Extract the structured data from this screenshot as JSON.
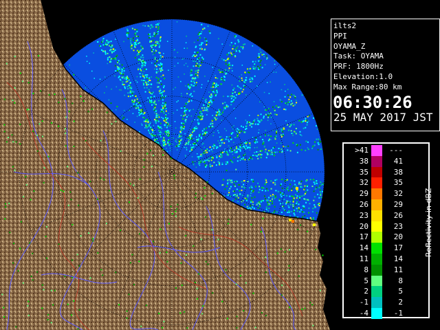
{
  "window": {
    "width": 640,
    "height": 480
  },
  "info": {
    "station": "ilts2",
    "mode": "PPI",
    "product": "OYAMA_Z",
    "task": "Task: OYAMA",
    "prf": "PRF: 1800Hz",
    "elevation": "Elevation:1.0",
    "max_range": "Max Range:80 km",
    "time": "06:30:26",
    "date": "25 MAY 2017 JST"
  },
  "legend": {
    "unit": "Reflectivity in dBZ",
    "rows": [
      {
        "lo": ">41",
        "hi": "---",
        "color": "#ff40ff"
      },
      {
        "lo": "38",
        "hi": "41",
        "color": "#b00060"
      },
      {
        "lo": "35",
        "hi": "38",
        "color": "#c00000"
      },
      {
        "lo": "32",
        "hi": "35",
        "color": "#ff2000"
      },
      {
        "lo": "29",
        "hi": "32",
        "color": "#ff7800"
      },
      {
        "lo": "26",
        "hi": "29",
        "color": "#ffb000"
      },
      {
        "lo": "23",
        "hi": "26",
        "color": "#ffe000"
      },
      {
        "lo": "20",
        "hi": "23",
        "color": "#ffff00"
      },
      {
        "lo": "17",
        "hi": "20",
        "color": "#b0ff00"
      },
      {
        "lo": "14",
        "hi": "17",
        "color": "#00e000"
      },
      {
        "lo": "11",
        "hi": "14",
        "color": "#00b000"
      },
      {
        "lo": "8",
        "hi": "11",
        "color": "#009000"
      },
      {
        "lo": "5",
        "hi": "8",
        "color": "#60ff80"
      },
      {
        "lo": "2",
        "hi": "5",
        "color": "#00d080"
      },
      {
        "lo": "-1",
        "hi": "2",
        "color": "#00c0c0"
      },
      {
        "lo": "-4",
        "hi": "-1",
        "color": "#00ffff"
      }
    ]
  },
  "map": {
    "sea_color": "#0a4ee0",
    "outside_color": "#000000",
    "land_color": "#8a6a48",
    "river_color": "#5a5aff",
    "coast_color": "#000000"
  }
}
